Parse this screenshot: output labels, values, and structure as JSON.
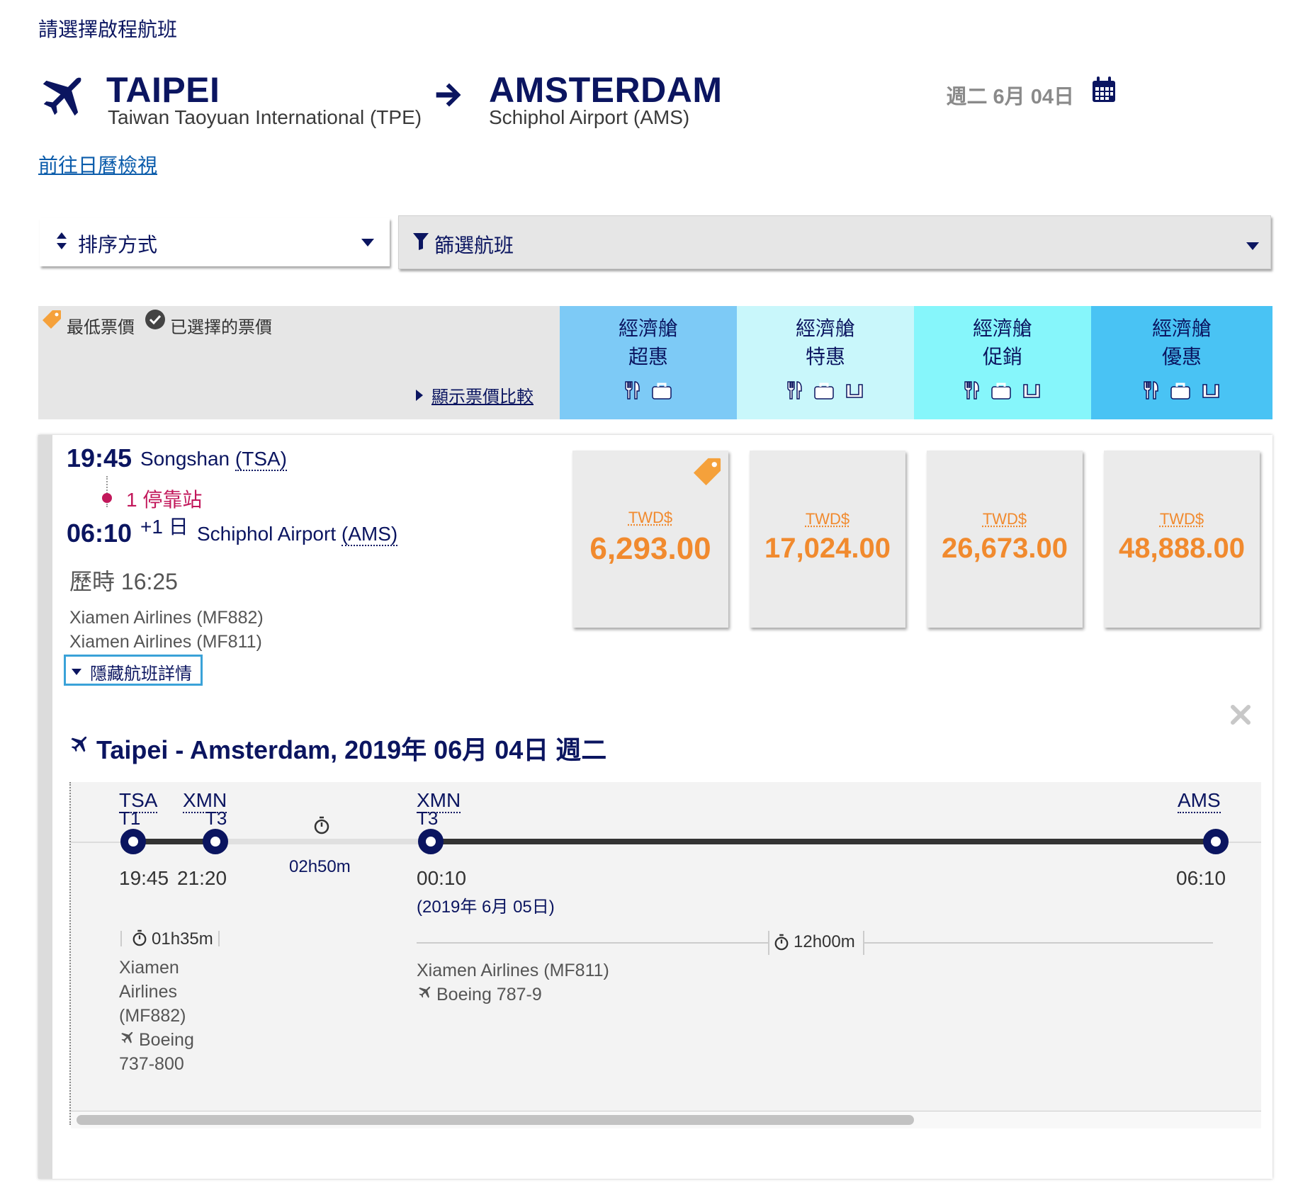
{
  "page": {
    "title": "請選擇啟程航班",
    "calendar_link": "前往日曆檢視",
    "date": "週二 6月 04日"
  },
  "route": {
    "from_city": "TAIPEI",
    "from_airport": "Taiwan Taoyuan International (TPE)",
    "to_city": "AMSTERDAM",
    "to_airport": "Schiphol Airport (AMS)"
  },
  "controls": {
    "sort_label": "排序方式",
    "filter_label": "篩選航班"
  },
  "legend": {
    "lowest": "最低票價",
    "selected": "已選擇的票價",
    "compare_link": "顯示票價比較"
  },
  "cabins": [
    {
      "line1": "經濟艙",
      "line2": "超惠",
      "color": "#7dcaf6"
    },
    {
      "line1": "經濟艙",
      "line2": "特惠",
      "color": "#c9f7fb"
    },
    {
      "line1": "經濟艙",
      "line2": "促銷",
      "color": "#86f6fb"
    },
    {
      "line1": "經濟艙",
      "line2": "優惠",
      "color": "#49c3f4"
    }
  ],
  "flight": {
    "dep_time": "19:45",
    "dep_airport": "Songshan",
    "dep_code": "(TSA)",
    "stops": "1 停靠站",
    "arr_time": "06:10",
    "day_offset": "+1 日",
    "arr_airport": "Schiphol Airport",
    "arr_code": "(AMS)",
    "duration": "歷時 16:25",
    "carrier1": "Xiamen Airlines (MF882)",
    "carrier2": "Xiamen Airlines (MF811)",
    "hide_details": "隱藏航班詳情",
    "prices": [
      {
        "currency": "TWD$",
        "amount": "6,293.00"
      },
      {
        "currency": "TWD$",
        "amount": "17,024.00"
      },
      {
        "currency": "TWD$",
        "amount": "26,673.00"
      },
      {
        "currency": "TWD$",
        "amount": "48,888.00"
      }
    ]
  },
  "details": {
    "heading": "Taipei - Amsterdam, 2019年 06月 04日 週二",
    "seg1": {
      "from_code": "TSA",
      "from_term": "T1",
      "to_code": "XMN",
      "to_term": "T3",
      "dep": "19:45",
      "arr": "21:20",
      "duration": "01h35m",
      "carrier_lines": [
        "Xiamen",
        "Airlines",
        "(MF882)"
      ],
      "aircraft_lines": [
        "Boeing",
        "737-800"
      ]
    },
    "layover": "02h50m",
    "seg2": {
      "from_code": "XMN",
      "from_term": "T3",
      "to_code": "AMS",
      "dep": "00:10",
      "dep_date": "(2019年 6月 05日)",
      "arr": "06:10",
      "duration": "12h00m",
      "carrier": "Xiamen Airlines (MF811)",
      "aircraft": "Boeing 787-9"
    }
  },
  "colors": {
    "navy": "#0b1560",
    "price": "#f18a2e",
    "stop": "#c2185b",
    "link": "#0b5cab"
  }
}
